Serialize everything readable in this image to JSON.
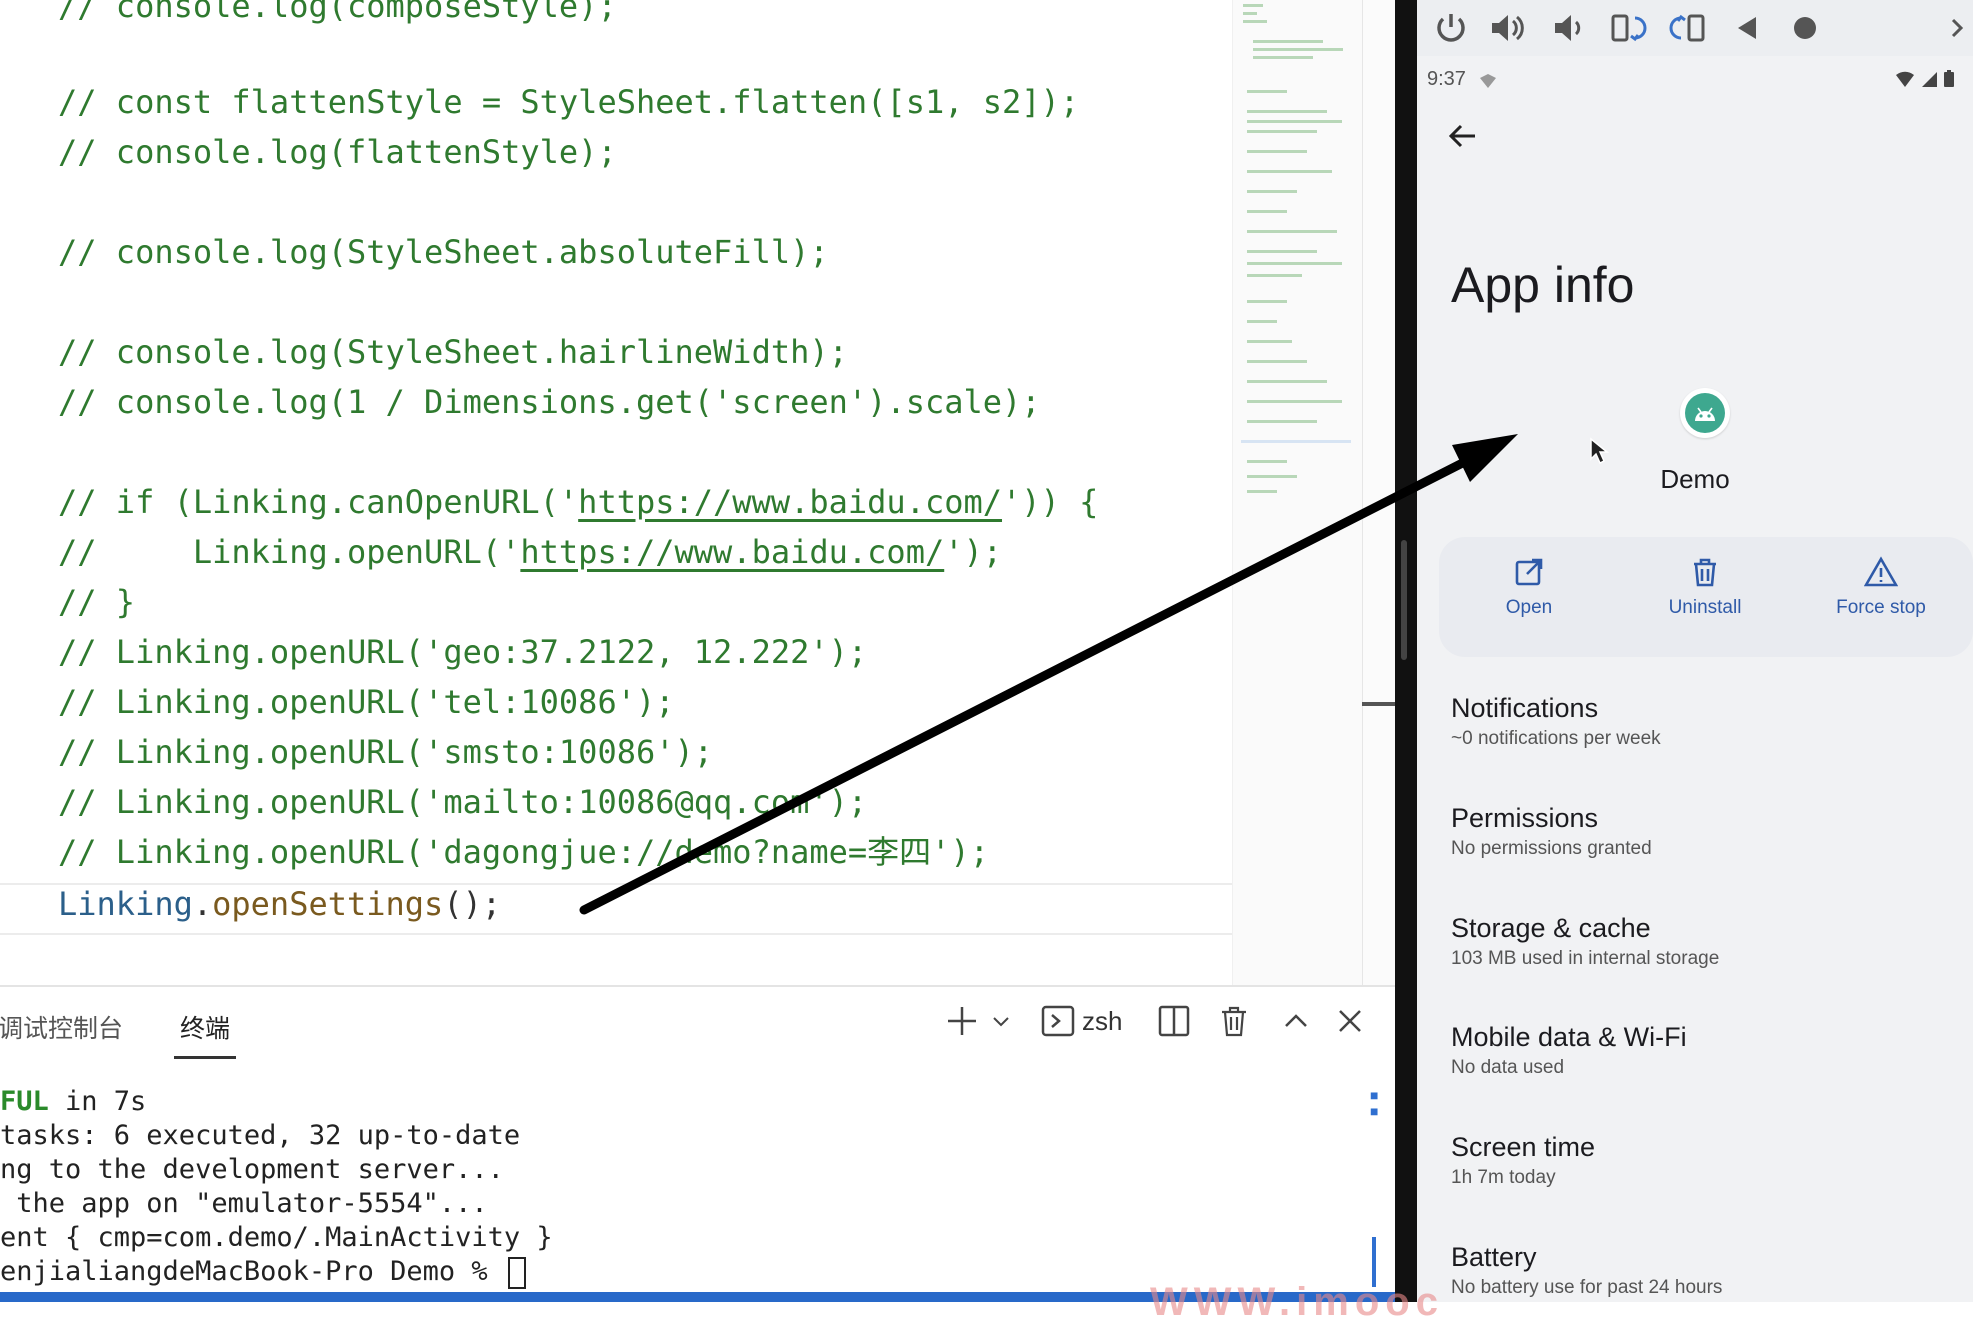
{
  "editor": {
    "lines": [
      {
        "text": "// console.log(composeStyle);"
      },
      {
        "text": "// const flattenStyle = StyleSheet.flatten([s1, s2]);"
      },
      {
        "text": "// console.log(flattenStyle);"
      },
      {
        "text": "// console.log(StyleSheet.absoluteFill);"
      },
      {
        "text": "// console.log(StyleSheet.hairlineWidth);"
      },
      {
        "text": "// console.log(1 / Dimensions.get('screen').scale);"
      },
      {
        "pre": "// if (Linking.canOpenURL('",
        "url": "https://www.baidu.com/",
        "post": "')) {"
      },
      {
        "pre": "//     Linking.openURL('",
        "url": "https://www.baidu.com/",
        "post": "');"
      },
      {
        "text": "// }"
      },
      {
        "text": "// Linking.openURL('geo:37.2122, 12.222');"
      },
      {
        "text": "// Linking.openURL('tel:10086');"
      },
      {
        "text": "// Linking.openURL('smsto:10086');"
      },
      {
        "text": "// Linking.openURL('mailto:10086@qq.com');"
      },
      {
        "text": "// Linking.openURL('dagongjue://demo?name=李四');"
      }
    ],
    "active_line": {
      "obj": "Linking",
      "dot": ".",
      "fn": "openSettings",
      "punc": "();"
    }
  },
  "panel": {
    "tabs": [
      "调试控制台",
      "终端"
    ],
    "active_tab": "终端",
    "shell_name": "zsh",
    "terminal_lines": [
      {
        "bold": "FUL",
        "rest": " in 7s"
      },
      {
        "rest": "tasks: 6 executed, 32 up-to-date"
      },
      {
        "rest": "ng to the development server..."
      },
      {
        "rest": " the app on \"emulator-5554\"..."
      },
      {
        "rest": "ent { cmp=com.demo/.MainActivity }"
      },
      {
        "rest": "enjialiangdeMacBook-Pro Demo % "
      }
    ]
  },
  "emulator": {
    "status_time": "9:37",
    "page_title": "App info",
    "app_name": "Demo",
    "actions": [
      "Open",
      "Uninstall",
      "Force stop"
    ],
    "settings": [
      {
        "title": "Notifications",
        "subtitle": "~0 notifications per week"
      },
      {
        "title": "Permissions",
        "subtitle": "No permissions granted"
      },
      {
        "title": "Storage & cache",
        "subtitle": "103 MB used in internal storage"
      },
      {
        "title": "Mobile data & Wi-Fi",
        "subtitle": "No data used"
      },
      {
        "title": "Screen time",
        "subtitle": "1h 7m today"
      },
      {
        "title": "Battery",
        "subtitle": "No battery use for past 24 hours"
      }
    ],
    "accent_color": "#2f5aa8"
  },
  "watermark": "WWW.imooc"
}
